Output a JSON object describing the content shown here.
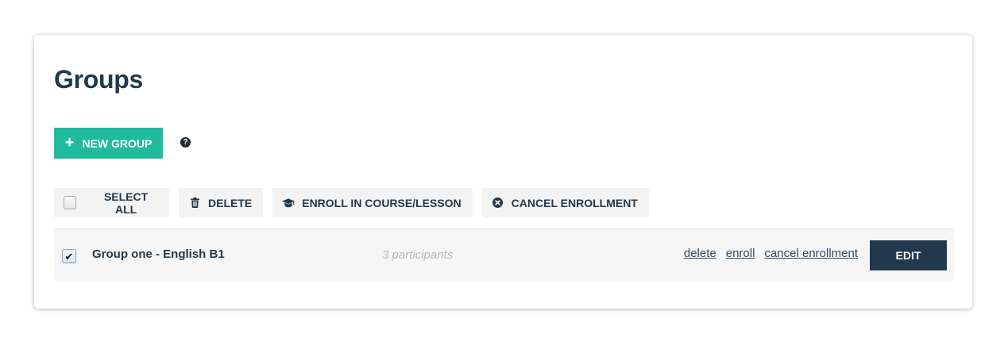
{
  "page": {
    "title": "Groups"
  },
  "actions": {
    "new_group_label": "NEW GROUP",
    "new_group_icon": "plus-icon",
    "help_icon": "question-circle-icon"
  },
  "toolbar": {
    "select_all_label": "SELECT ALL",
    "delete_label": "DELETE",
    "delete_icon": "trash-icon",
    "enroll_label": "ENROLL IN COURSE/LESSON",
    "enroll_icon": "graduation-cap-icon",
    "cancel_enrollment_label": "CANCEL ENROLLMENT",
    "cancel_enrollment_icon": "times-circle-icon"
  },
  "groups": [
    {
      "checked": true,
      "name": "Group one - English B1",
      "participants": "3 participants",
      "links": {
        "delete": "delete",
        "enroll": "enroll",
        "cancel_enrollment": "cancel enrollment"
      },
      "edit_label": "EDIT"
    }
  ],
  "colors": {
    "accent": "#1fbb9c",
    "primary_dark": "#22394d",
    "row_background": "#f6f6f6",
    "toolbar_background": "#f3f3f3",
    "muted_text": "#b3b8bd"
  }
}
